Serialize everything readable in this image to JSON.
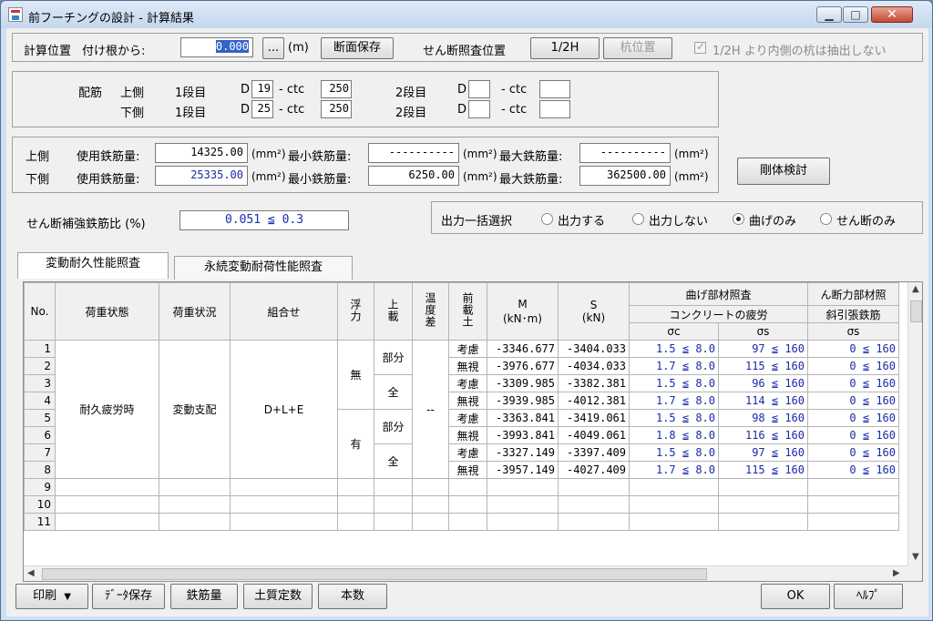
{
  "window": {
    "title": "前フーチングの設計 - 計算結果",
    "min": "▁",
    "max": "□",
    "close": "✕"
  },
  "calcpos": {
    "label": "計算位置",
    "from_base": "付け根から:",
    "value": "0.000",
    "browse": "...",
    "unit": "(m)",
    "save_section": "断面保存",
    "shear_label": "せん断照査位置",
    "half_h": "1/2H",
    "pile_pos": "杭位置",
    "exclude_text": "1/2H より内側の杭は抽出しない"
  },
  "rebar": {
    "label": "配筋",
    "upper": "上側",
    "lower": "下側",
    "tier1": "1段目",
    "tier2": "2段目",
    "d": "D",
    "ctc": "- ctc",
    "upper_d1": "19",
    "upper_ctc1": "250",
    "lower_d1": "25",
    "lower_ctc1": "250",
    "upper_d2": "",
    "upper_ctc2": "",
    "lower_d2": "",
    "lower_ctc2": ""
  },
  "steel": {
    "upper": "上側",
    "lower": "下側",
    "used": "使用鉄筋量:",
    "min": "最小鉄筋量:",
    "max": "最大鉄筋量:",
    "unit": "(mm²)",
    "upper_used": "14325.00",
    "upper_min": "----------",
    "upper_max": "----------",
    "lower_used": "25335.00",
    "lower_min": "6250.00",
    "lower_max": "362500.00",
    "rigid_check": "剛体検討"
  },
  "shear_ratio": {
    "label": "せん断補強鉄筋比 (%)",
    "value": "0.051 ≦ 0.3"
  },
  "output": {
    "label": "出力一括選択",
    "options": [
      "出力する",
      "出力しない",
      "曲げのみ",
      "せん断のみ"
    ],
    "selected": 2
  },
  "tabs": [
    "変動耐久性能照査",
    "永続変動耐荷性能照査"
  ],
  "grid": {
    "headers": {
      "no": "No.",
      "load_state": "荷重状態",
      "load_cond": "荷重状況",
      "combo": "組合せ",
      "buoyancy": "浮力",
      "surcharge": "上載",
      "temp": "温度差",
      "front_soil": "前載土",
      "m": "M",
      "m_unit": "(kN･m)",
      "s": "S",
      "s_unit": "(kN)",
      "bend_check": "曲げ部材照査",
      "concrete_fatigue": "コンクリートの疲労",
      "sigma_c": "σc",
      "sigma_s": "σs",
      "shear_check": "ん断力部材照",
      "diag_rebar": "斜引張鉄筋",
      "sigma_s2": "σs"
    },
    "group": {
      "load_state": "耐久疲労時",
      "load_cond": "変動支配",
      "combo": "D+L+E",
      "temp": "--"
    },
    "buoyancy": [
      "無",
      "有"
    ],
    "surcharge": [
      "部分",
      "全",
      "部分",
      "全"
    ],
    "rows": [
      {
        "no": "1",
        "soil": "考慮",
        "m": "-3346.677",
        "s": "-3404.033",
        "sc": "1.5 ≦  8.0",
        "ss": "97 ≦  160",
        "ss2": "0 ≦  160"
      },
      {
        "no": "2",
        "soil": "無視",
        "m": "-3976.677",
        "s": "-4034.033",
        "sc": "1.7 ≦  8.0",
        "ss": "115 ≦  160",
        "ss2": "0 ≦  160"
      },
      {
        "no": "3",
        "soil": "考慮",
        "m": "-3309.985",
        "s": "-3382.381",
        "sc": "1.5 ≦  8.0",
        "ss": "96 ≦  160",
        "ss2": "0 ≦  160"
      },
      {
        "no": "4",
        "soil": "無視",
        "m": "-3939.985",
        "s": "-4012.381",
        "sc": "1.7 ≦  8.0",
        "ss": "114 ≦  160",
        "ss2": "0 ≦  160"
      },
      {
        "no": "5",
        "soil": "考慮",
        "m": "-3363.841",
        "s": "-3419.061",
        "sc": "1.5 ≦  8.0",
        "ss": "98 ≦  160",
        "ss2": "0 ≦  160"
      },
      {
        "no": "6",
        "soil": "無視",
        "m": "-3993.841",
        "s": "-4049.061",
        "sc": "1.8 ≦  8.0",
        "ss": "116 ≦  160",
        "ss2": "0 ≦  160"
      },
      {
        "no": "7",
        "soil": "考慮",
        "m": "-3327.149",
        "s": "-3397.409",
        "sc": "1.5 ≦  8.0",
        "ss": "97 ≦  160",
        "ss2": "0 ≦  160"
      },
      {
        "no": "8",
        "soil": "無視",
        "m": "-3957.149",
        "s": "-4027.409",
        "sc": "1.7 ≦  8.0",
        "ss": "115 ≦  160",
        "ss2": "0 ≦  160"
      }
    ],
    "empty_rows": [
      "9",
      "10",
      "11"
    ]
  },
  "footer": {
    "print": "印刷",
    "print_arrow": "▼",
    "save_data": "ﾃﾞｰﾀ保存",
    "rebar_amount": "鉄筋量",
    "soil_const": "土質定数",
    "count": "本数",
    "ok": "OK",
    "help": "ﾍﾙﾌﾟ"
  }
}
